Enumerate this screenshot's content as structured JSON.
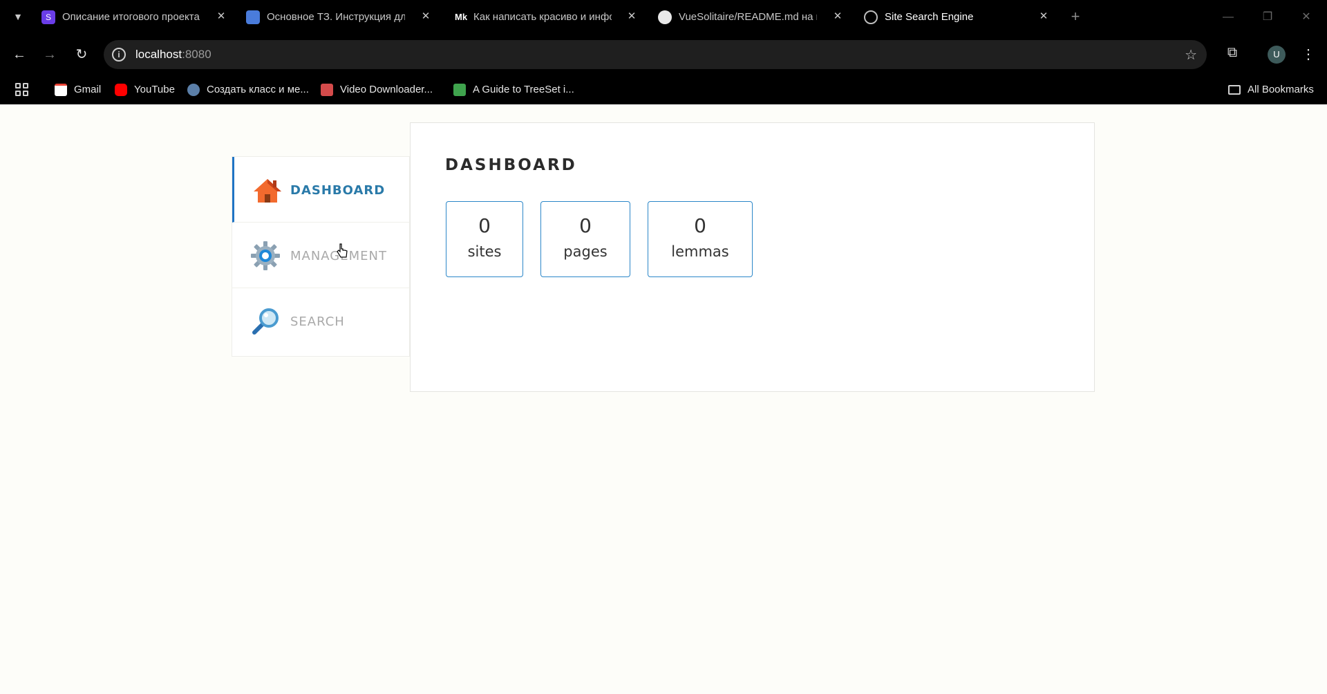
{
  "browser": {
    "tabs": [
      {
        "title": "Описание итогового проекта",
        "favicon_color": "#6a3de8",
        "favicon_letter": "S"
      },
      {
        "title": "Основное ТЗ. Инструкция для",
        "favicon_color": "#4a7cdb",
        "favicon_letter": ""
      },
      {
        "title": "Как написать красиво и инфор",
        "favicon_color": "#000000",
        "favicon_letter": "Mk"
      },
      {
        "title": "VueSolitaire/README.md на m",
        "favicon_color": "#000000",
        "favicon_letter": ""
      },
      {
        "title": "Site Search Engine",
        "favicon_color": "#000000",
        "favicon_letter": "",
        "active": true
      }
    ],
    "url_host": "localhost",
    "url_port": ":8080",
    "avatar_letter": "U",
    "bookmarks": [
      {
        "label": "Gmail",
        "icon": "gmail-icon"
      },
      {
        "label": "YouTube",
        "icon": "youtube-icon"
      },
      {
        "label": "Создать класс и ме...",
        "icon": "puzzle-icon"
      },
      {
        "label": "Video Downloader...",
        "icon": "video-icon"
      },
      {
        "label": "A Guide to TreeSet i...",
        "icon": "leaf-icon"
      }
    ],
    "all_bookmarks": "All Bookmarks"
  },
  "sidebar": {
    "items": [
      {
        "label": "DASHBOARD",
        "icon": "home-icon",
        "active": true
      },
      {
        "label": "MANAGEMENT",
        "icon": "gear-icon",
        "active": false
      },
      {
        "label": "SEARCH",
        "icon": "magnifier-icon",
        "active": false
      }
    ]
  },
  "dashboard": {
    "title": "DASHBOARD",
    "stats": [
      {
        "value": "0",
        "label": "sites"
      },
      {
        "value": "0",
        "label": "pages"
      },
      {
        "value": "0",
        "label": "lemmas"
      }
    ]
  },
  "colors": {
    "accent": "#2a86c8",
    "active_text": "#2a7aa9",
    "inactive_text": "#a9a9a9"
  }
}
